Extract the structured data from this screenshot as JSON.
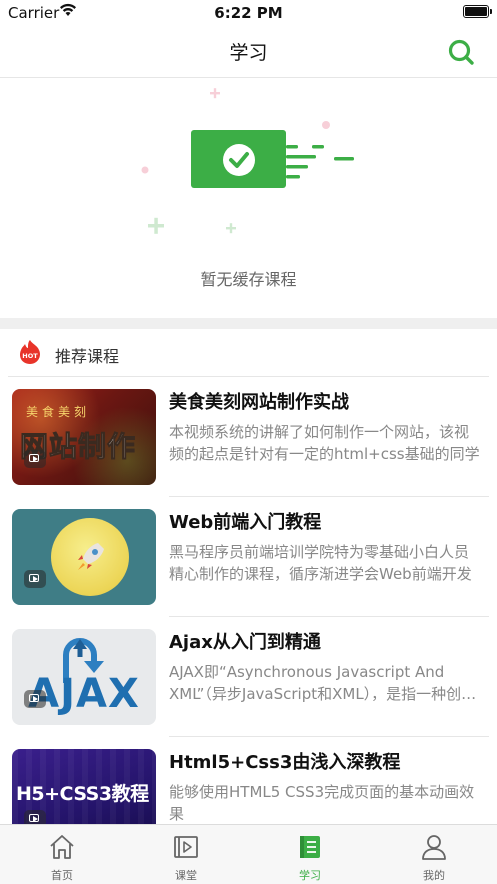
{
  "status_bar": {
    "carrier": "Carrier",
    "time": "6:22 PM"
  },
  "nav": {
    "title": "学习",
    "accent_color": "#3cae46"
  },
  "empty_state": {
    "text": "暂无缓存课程"
  },
  "recommended": {
    "title": "推荐课程",
    "hot_badge": "HOT",
    "courses": [
      {
        "title": "美食美刻网站制作实战",
        "description": "本视频系统的讲解了如何制作一个网站，该视频的起点是针对有一定的html+css基础的同学",
        "thumb_text_top": "美食美刻",
        "thumb_text_main": "网站制作"
      },
      {
        "title": "Web前端入门教程",
        "description": "黑马程序员前端培训学院特为零基础小白人员精心制作的课程，循序渐进学会Web前端开发",
        "thumb_text_top": "",
        "thumb_text_main": ""
      },
      {
        "title": "Ajax从入门到精通",
        "description": "AJAX即“Asynchronous Javascript And XML”（异步JavaScript和XML），是指一种创建交互式网页应用的网页开发技术",
        "thumb_text_top": "",
        "thumb_text_main": "AJAX"
      },
      {
        "title": "Html5+Css3由浅入深教程",
        "description": "能够使用HTML5 CSS3完成页面的基本动画效果",
        "thumb_text_top": "",
        "thumb_text_main": "H5+CSS3教程"
      }
    ]
  },
  "tabbar": {
    "tabs": [
      {
        "label": "首页",
        "icon": "home-icon",
        "active": false
      },
      {
        "label": "课堂",
        "icon": "video-icon",
        "active": false
      },
      {
        "label": "学习",
        "icon": "book-icon",
        "active": true
      },
      {
        "label": "我的",
        "icon": "user-icon",
        "active": false
      }
    ]
  }
}
